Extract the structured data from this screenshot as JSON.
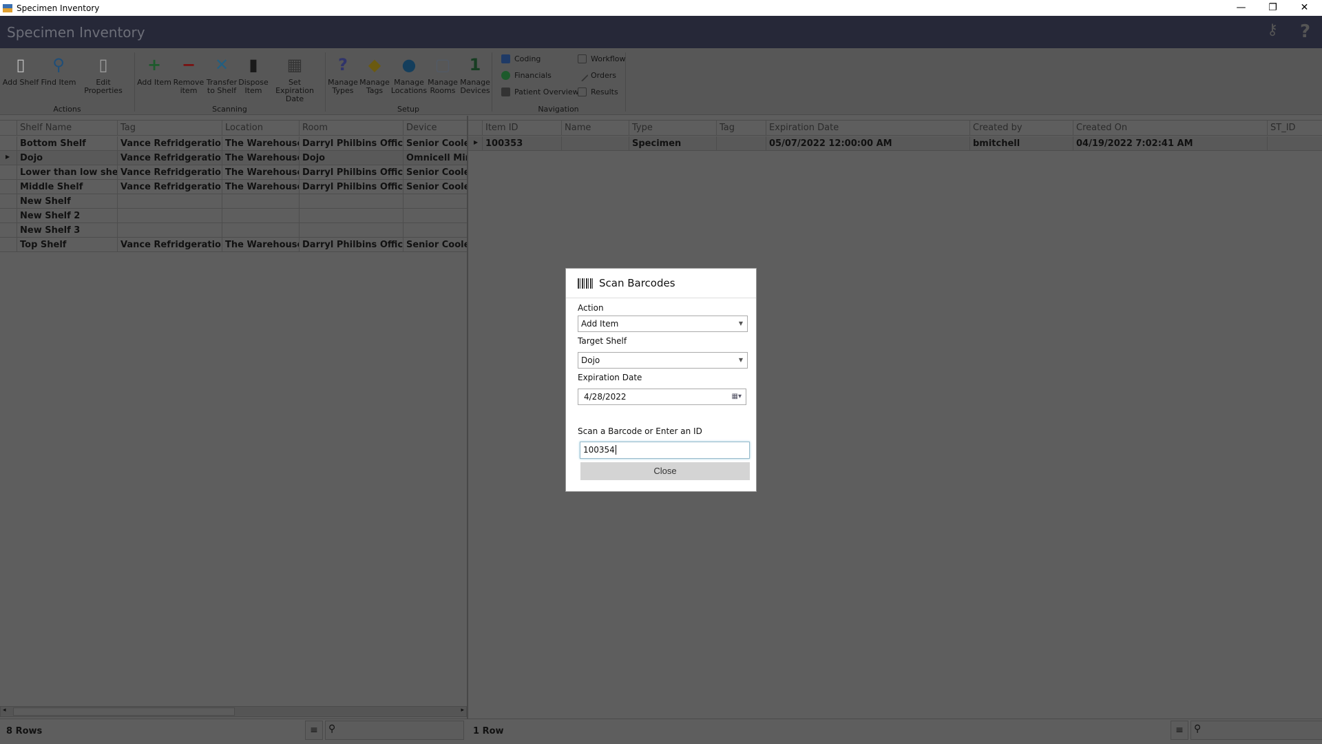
{
  "window": {
    "title": "Specimen Inventory",
    "minimize": "—",
    "restore": "❐",
    "close": "✕"
  },
  "header": {
    "title": "Specimen Inventory",
    "keys_icon": "keys-icon",
    "help": "?"
  },
  "toolbar": {
    "groups": [
      {
        "label": "Actions"
      },
      {
        "label": "Scanning"
      },
      {
        "label": "Setup"
      },
      {
        "label": "Navigation"
      }
    ],
    "buttons": [
      {
        "l1": "Add Shelf",
        "l2": "",
        "icon": "▯",
        "color": "#b9b9b9"
      },
      {
        "l1": "Find Item",
        "l2": "",
        "icon": "⚲",
        "color": "#1f4e78"
      },
      {
        "l1": "Edit Properties",
        "l2": "",
        "icon": "▯",
        "color": "#9a9a9a"
      },
      {
        "l1": "Add Item",
        "l2": "",
        "icon": "+",
        "color": "#1d5a2c"
      },
      {
        "l1": "Remove",
        "l2": "item",
        "icon": "−",
        "color": "#7a1010"
      },
      {
        "l1": "Transfer",
        "l2": "to Shelf",
        "icon": "✕",
        "color": "#235f80"
      },
      {
        "l1": "Dispose",
        "l2": "Item",
        "icon": "▮",
        "color": "#1a1a1a"
      },
      {
        "l1": "Set Expiration",
        "l2": "Date",
        "icon": "▦",
        "color": "#333"
      },
      {
        "l1": "Manage",
        "l2": "Types",
        "icon": "?",
        "color": "#30346a"
      },
      {
        "l1": "Manage",
        "l2": "Tags",
        "icon": "◆",
        "color": "#6b5a10"
      },
      {
        "l1": "Manage",
        "l2": "Locations",
        "icon": "●",
        "color": "#143e5c"
      },
      {
        "l1": "Manage",
        "l2": "Rooms",
        "icon": "▢",
        "color": "#525a66"
      },
      {
        "l1": "Manage",
        "l2": "Devices",
        "icon": "1",
        "color": "#173d22"
      }
    ],
    "nav": [
      {
        "label": "Coding",
        "color": "#1f3a66"
      },
      {
        "label": "Financials",
        "color": "#1d5a2c"
      },
      {
        "label": "Patient Overview",
        "color": "#333"
      },
      {
        "label": "Workflow",
        "color": "#333"
      },
      {
        "label": "Orders",
        "color": "#333"
      },
      {
        "label": "Results",
        "color": "#333"
      }
    ]
  },
  "shelves": {
    "columns": [
      "Shelf Name",
      "Tag",
      "Location",
      "Room",
      "Device"
    ],
    "rows": [
      [
        "Bottom Shelf",
        "Vance Refridgeration",
        "The Warehouse",
        "Darryl Philbins Office",
        "Senior Cooler"
      ],
      [
        "Dojo",
        "Vance Refridgeration",
        "The Warehouse",
        "Dojo",
        "Omnicell Mini"
      ],
      [
        "Lower than low shelf",
        "Vance Refridgeration",
        "The Warehouse",
        "Darryl Philbins Office",
        "Senior Cooler"
      ],
      [
        "Middle Shelf",
        "Vance Refridgeration",
        "The Warehouse",
        "Darryl Philbins Office",
        "Senior Cooler"
      ],
      [
        "New Shelf",
        "",
        "",
        "",
        ""
      ],
      [
        "New Shelf 2",
        "",
        "",
        "",
        ""
      ],
      [
        "New Shelf 3",
        "",
        "",
        "",
        ""
      ],
      [
        "Top Shelf",
        "Vance Refridgeration",
        "The Warehouse",
        "Darryl Philbins Office",
        "Senior Cooler"
      ]
    ],
    "status": "8 Rows"
  },
  "items": {
    "columns": [
      "Item ID",
      "Name",
      "Type",
      "Tag",
      "Expiration Date",
      "Created by",
      "Created On",
      "ST_ID"
    ],
    "rows": [
      [
        "100353",
        "",
        "Specimen",
        "",
        "05/07/2022 12:00:00 AM",
        "bmitchell",
        "04/19/2022 7:02:41 AM",
        ""
      ]
    ],
    "status": "1 Row"
  },
  "dialog": {
    "title": "Scan Barcodes",
    "action_label": "Action",
    "action_value": "Add Item",
    "shelf_label": "Target Shelf",
    "shelf_value": "Dojo",
    "date_label": "Expiration Date",
    "date_value": "4/28/2022",
    "scan_label": "Scan a Barcode or Enter an ID",
    "scan_value": "100354",
    "close": "Close"
  }
}
